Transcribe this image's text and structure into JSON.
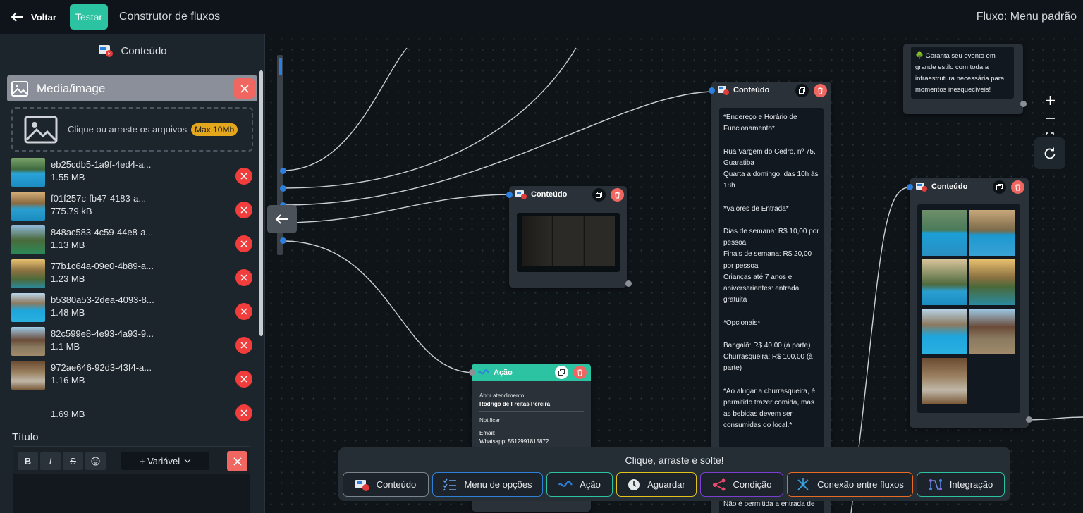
{
  "header": {
    "back_label": "Voltar",
    "test_label": "Testar",
    "app_title": "Construtor de fluxos",
    "flow_name": "Fluxo: Menu padrão"
  },
  "sidebar": {
    "section_title": "Conteúdo",
    "media_label": "Media/image",
    "dropzone_text": "Clique ou arraste os arquivos",
    "max_badge": "Max 10Mb",
    "files": [
      {
        "name": "eb25cdb5-1a9f-4ed4-a...",
        "size": "1.55 MB"
      },
      {
        "name": "f01f257c-fb47-4183-a...",
        "size": "775.79 kB"
      },
      {
        "name": "848ac583-4c59-44e8-a...",
        "size": "1.13 MB"
      },
      {
        "name": "77b1c64a-09e0-4b89-a...",
        "size": "1.23 MB"
      },
      {
        "name": "b5380a53-2dea-4093-8...",
        "size": "1.48 MB"
      },
      {
        "name": "82c599e8-4e93-4a93-9...",
        "size": "1.1 MB"
      },
      {
        "name": "972ae646-92d3-43f4-a...",
        "size": "1.16 MB"
      },
      {
        "name": "",
        "size": "1.69 MB"
      }
    ],
    "title_label": "Título",
    "toolbar": {
      "bold": "B",
      "italic": "I",
      "strike": "S",
      "variable": "+ Variável"
    }
  },
  "canvas": {
    "node_menu": {
      "title": "Conteúdo"
    },
    "node_action": {
      "title": "Ação",
      "line1_label": "Abrir atendimento",
      "line1_value": "Rodrigo de Freitas Pereira",
      "line2_label": "Notificar",
      "line3_label": "Email:",
      "line3_value": "Whatsapp: 5512991815872"
    },
    "node_info": {
      "title": "Conteúdo",
      "text": "*Endereço e Horário de Funcionamento*\n\nRua Vargem do Cedro, nº 75, Guaratiba\nQuarta a domingo, das 10h às 18h\n\n*Valores de Entrada*\n\nDias de semana: R$ 10,00 por pessoa\nFinais de semana: R$ 20,00 por pessoa\nCrianças até 7 anos e aniversariantes: entrada gratuita\n\n*Opcionais*\n\nBangalô: R$ 40,00 (à parte)\nChurrasqueira: R$ 100,00 (à parte)\n\n*Ao alugar a churrasqueira, é permitido trazer comida, mas as bebidas devem ser consumidas do local.*",
      "bottom_text": "Não é permitida a entrada de"
    },
    "node_event": {
      "text": "🌳 Garanta seu evento em grande estilo com toda a infraestrutura necessária para momentos inesquecíveis!"
    },
    "node_gallery": {
      "title": "Conteúdo"
    }
  },
  "palette": {
    "title": "Clique, arraste e solte!",
    "items": [
      {
        "label": "Conteúdo",
        "color": "#7b8590"
      },
      {
        "label": "Menu de opções",
        "color": "#2f7fd6"
      },
      {
        "label": "Ação",
        "color": "#2bc3a1"
      },
      {
        "label": "Aguardar",
        "color": "#e2c21c"
      },
      {
        "label": "Condição",
        "color": "#7a3fd1"
      },
      {
        "label": "Conexão entre fluxos",
        "color": "#e96a22"
      },
      {
        "label": "Integração",
        "color": "#2bc3a1"
      }
    ]
  }
}
